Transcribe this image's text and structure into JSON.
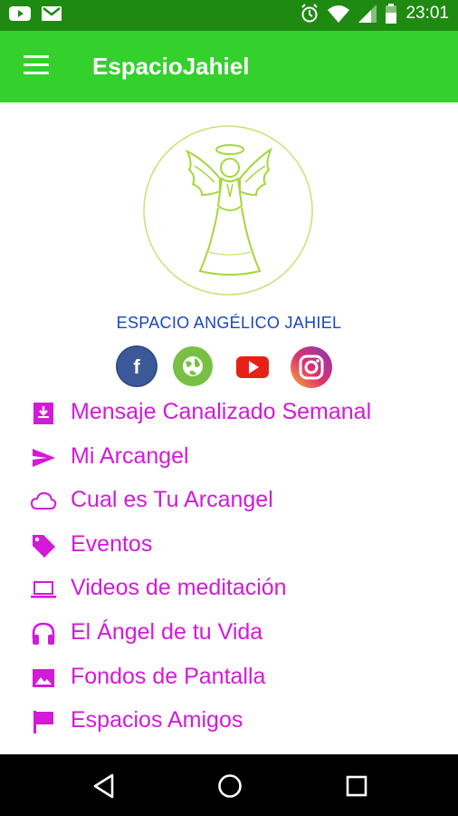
{
  "status_bar": {
    "time": "23:01",
    "icons": [
      "youtube-notification-icon",
      "gmail-notification-icon",
      "alarm-icon",
      "wifi-icon",
      "signal-icon",
      "battery-icon"
    ]
  },
  "app_bar": {
    "title": "EspacioJahiel",
    "menu_icon": "hamburger-icon"
  },
  "brand": {
    "caption": "ESPACIO ANGÉLICO JAHIEL"
  },
  "social": [
    {
      "name": "facebook",
      "icon": "facebook-icon",
      "color": "#3b5998",
      "glyph": "f"
    },
    {
      "name": "website",
      "icon": "globe-icon",
      "color": "#77c043"
    },
    {
      "name": "youtube",
      "icon": "youtube-icon",
      "color": "#e62117"
    },
    {
      "name": "instagram",
      "icon": "instagram-icon",
      "color": "#c13584"
    }
  ],
  "menu": {
    "items": [
      {
        "label": "Mensaje Canalizado Semanal",
        "icon": "download-box-icon"
      },
      {
        "label": "Mi Arcangel",
        "icon": "send-icon"
      },
      {
        "label": "Cual es Tu Arcangel",
        "icon": "cloud-icon"
      },
      {
        "label": "Eventos",
        "icon": "tag-icon"
      },
      {
        "label": "Videos de meditación",
        "icon": "laptop-icon"
      },
      {
        "label": "El Ángel de tu Vida",
        "icon": "headphones-icon"
      },
      {
        "label": "Fondos de Pantalla",
        "icon": "image-icon"
      },
      {
        "label": "Espacios Amigos",
        "icon": "flag-icon"
      }
    ]
  },
  "colors": {
    "status_bar": "#1f8a12",
    "app_bar": "#34d02c",
    "menu_text": "#d31ad9",
    "caption": "#1746c6",
    "logo_line": "#a6d63a"
  },
  "nav": {
    "buttons": [
      "back-icon",
      "home-icon",
      "recents-icon"
    ]
  }
}
